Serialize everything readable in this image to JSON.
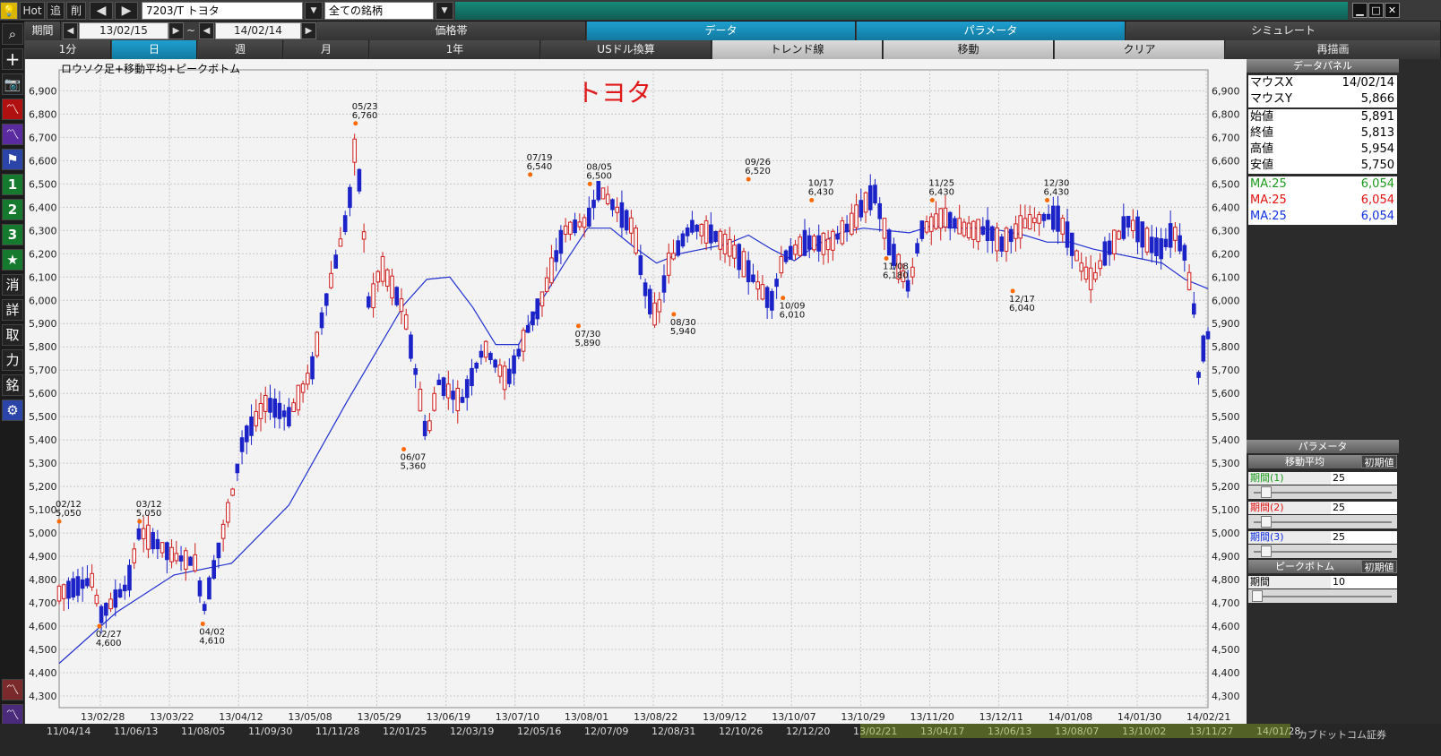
{
  "titlebar": {
    "hot_label": "Hot",
    "add_label": "追",
    "delete_label": "削",
    "symbol_value": "7203/T トヨタ",
    "universe_value": "全ての銘柄",
    "window_min": "▁",
    "window_max": "□",
    "window_close": "✕"
  },
  "left_tools": {
    "btn1": "1",
    "btn2": "2",
    "btn3": "3",
    "erase": "消",
    "detail": "詳",
    "trade": "取",
    "power": "力",
    "stock": "銘"
  },
  "row1": {
    "period_label": "期間",
    "date_from": "13/02/15",
    "tilde": "~",
    "date_to": "14/02/14",
    "tabs": [
      "価格帯",
      "データ",
      "パラメータ",
      "シミュレート"
    ]
  },
  "row2": {
    "timeframes": [
      "1分",
      "日",
      "週",
      "月",
      "1年"
    ],
    "buttons": [
      "USドル換算",
      "トレンド線",
      "移動",
      "クリア"
    ],
    "redraw": "再描画"
  },
  "chart": {
    "caption": "ロウソク足+移動平均+ピークボトム",
    "big_title": "トヨタ",
    "grid": true
  },
  "chart_data": {
    "type": "candlestick",
    "symbol": "7203/T",
    "title": "トヨタ",
    "ylim": [
      4250,
      6990
    ],
    "y_ticks": [
      4300,
      4400,
      4500,
      4600,
      4700,
      4800,
      4900,
      5000,
      5100,
      5200,
      5300,
      5400,
      5500,
      5600,
      5700,
      5800,
      5900,
      6000,
      6100,
      6200,
      6300,
      6400,
      6500,
      6600,
      6700,
      6800,
      6900
    ],
    "y_tick_labels": [
      "4,300",
      "4,400",
      "4,500",
      "4,600",
      "4,700",
      "4,800",
      "4,900",
      "5,000",
      "5,100",
      "5,200",
      "5,300",
      "5,400",
      "5,500",
      "5,600",
      "5,700",
      "5,800",
      "5,900",
      "6,000",
      "6,100",
      "6,200",
      "6,300",
      "6,400",
      "6,500",
      "6,600",
      "6,700",
      "6,800",
      "6,900"
    ],
    "x_tick_labels": [
      "13/02/28",
      "13/03/22",
      "13/04/12",
      "13/05/08",
      "13/05/29",
      "13/06/19",
      "13/07/10",
      "13/08/01",
      "13/08/22",
      "13/09/12",
      "13/10/07",
      "13/10/29",
      "13/11/20",
      "13/12/11",
      "14/01/08",
      "14/01/30",
      "14/02/21"
    ],
    "peak_bottom_labels": [
      {
        "date": "02/12",
        "value": 5050
      },
      {
        "date": "02/27",
        "value": 4600
      },
      {
        "date": "03/12",
        "value": 5050
      },
      {
        "date": "04/02",
        "value": 4610
      },
      {
        "date": "05/23",
        "value": 6760
      },
      {
        "date": "06/07",
        "value": 5360
      },
      {
        "date": "07/19",
        "value": 6540
      },
      {
        "date": "07/30",
        "value": 5890
      },
      {
        "date": "08/05",
        "value": 6500
      },
      {
        "date": "08/30",
        "value": 5940
      },
      {
        "date": "09/26",
        "value": 6520
      },
      {
        "date": "10/09",
        "value": 6010
      },
      {
        "date": "10/17",
        "value": 6430
      },
      {
        "date": "11/08",
        "value": 6180
      },
      {
        "date": "11/25",
        "value": 6430
      },
      {
        "date": "12/17",
        "value": 6040
      },
      {
        "date": "12/30",
        "value": 6430
      }
    ],
    "ma_line": {
      "name": "MA:25",
      "x": [
        0,
        0.05,
        0.1,
        0.15,
        0.2,
        0.25,
        0.3,
        0.32,
        0.34,
        0.36,
        0.38,
        0.4,
        0.42,
        0.44,
        0.46,
        0.48,
        0.5,
        0.52,
        0.54,
        0.56,
        0.58,
        0.6,
        0.62,
        0.64,
        0.66,
        0.68,
        0.7,
        0.72,
        0.74,
        0.76,
        0.78,
        0.8,
        0.82,
        0.84,
        0.86,
        0.88,
        0.9,
        0.92,
        0.94,
        0.96,
        0.98,
        1.0
      ],
      "values": [
        4440,
        4660,
        4820,
        4870,
        5120,
        5560,
        5980,
        6090,
        6100,
        5970,
        5810,
        5810,
        6000,
        6160,
        6310,
        6310,
        6230,
        6160,
        6200,
        6220,
        6240,
        6280,
        6220,
        6170,
        6240,
        6290,
        6310,
        6300,
        6290,
        6320,
        6310,
        6310,
        6300,
        6280,
        6250,
        6250,
        6220,
        6200,
        6180,
        6160,
        6090,
        6050
      ]
    },
    "legend": "none"
  },
  "data_panel": {
    "title": "データパネル",
    "rows": [
      {
        "key": "マウスX",
        "value": "14/02/14"
      },
      {
        "key": "マウスY",
        "value": "5,866"
      },
      {
        "key": "始値",
        "value": "5,891"
      },
      {
        "key": "終値",
        "value": "5,813"
      },
      {
        "key": "高値",
        "value": "5,954"
      },
      {
        "key": "安値",
        "value": "5,750"
      }
    ],
    "ma_rows": [
      {
        "key": "MA:25",
        "value": "6,054",
        "color": "#1a9a1a"
      },
      {
        "key": "MA:25",
        "value": "6,054",
        "color": "#e01010"
      },
      {
        "key": "MA:25",
        "value": "6,054",
        "color": "#1030e0"
      }
    ]
  },
  "param_panel": {
    "title": "パラメータ",
    "ma_section": "移動平均",
    "reset": "初期値",
    "params": [
      {
        "label": "期間(1)",
        "value": "25",
        "color": "#1a9a1a"
      },
      {
        "label": "期間(2)",
        "value": "25",
        "color": "#e01010"
      },
      {
        "label": "期間(3)",
        "value": "25",
        "color": "#1030e0"
      }
    ],
    "pb_section": "ピークボトム",
    "pb_param": {
      "label": "期間",
      "value": "10"
    }
  },
  "bottom_strip": {
    "dates": [
      "11/04/14",
      "11/06/13",
      "11/08/05",
      "11/09/30",
      "11/11/28",
      "12/01/25",
      "12/03/19",
      "12/05/16",
      "12/07/09",
      "12/08/31",
      "12/10/26",
      "12/12/20",
      "13/02/21",
      "13/04/17",
      "13/06/13",
      "13/08/07",
      "13/10/02",
      "13/11/27",
      "14/01/28"
    ],
    "footer": "カブドットコム証券"
  }
}
